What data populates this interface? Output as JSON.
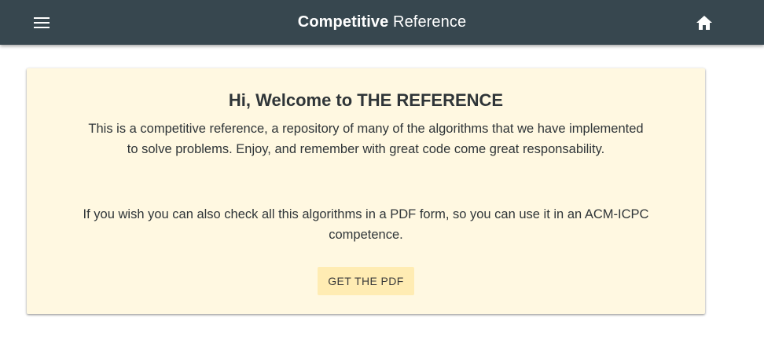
{
  "header": {
    "title_bold": "Competitive",
    "title_light": "Reference",
    "background_color": "#37474f",
    "menu_icon": "hamburger-menu-icon",
    "home_icon": "home-icon"
  },
  "card": {
    "title": "Hi, Welcome to THE REFERENCE",
    "paragraph_1": "This is a competitive reference, a repository of many of the algorithms that we have implemented to solve problems. Enjoy, and remember with great code come great responsability.",
    "paragraph_2": "If you wish you can also check all this algorithms in a PDF form, so you can use it in an ACM-ICPC competence.",
    "button_label": "GET THE PDF",
    "background_color": "#fff8e1",
    "button_color": "#ffecb3"
  }
}
